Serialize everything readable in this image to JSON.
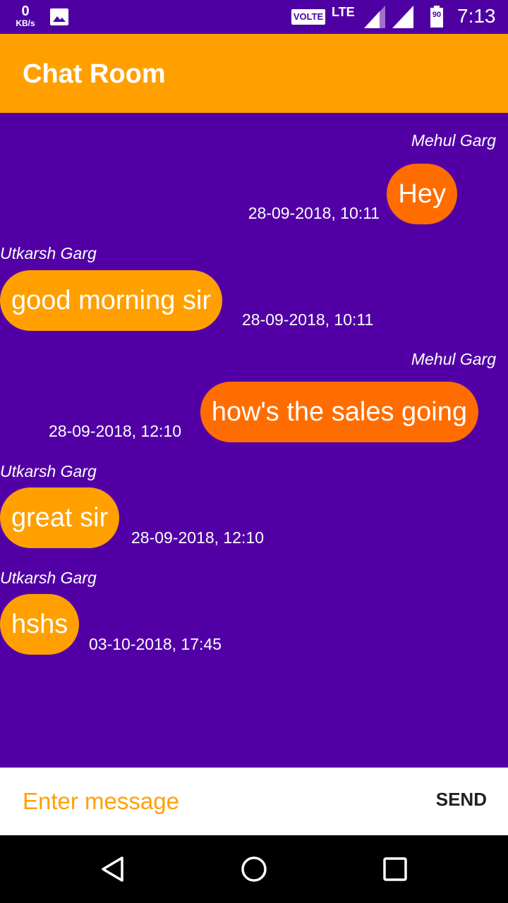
{
  "status_bar": {
    "net_speed_value": "0",
    "net_speed_unit": "KB/s",
    "volte_label": "VOLTE",
    "network_type": "LTE",
    "battery_level": "90",
    "time": "7:13"
  },
  "app_bar": {
    "title": "Chat Room"
  },
  "messages": [
    {
      "sender": "Mehul Garg",
      "text": "Hey",
      "timestamp": "28-09-2018, 10:11",
      "direction": "sent"
    },
    {
      "sender": "Utkarsh Garg",
      "text": "good morning sir",
      "timestamp": "28-09-2018, 10:11",
      "direction": "received"
    },
    {
      "sender": "Mehul Garg",
      "text": "how's the sales going",
      "timestamp": "28-09-2018, 12:10",
      "direction": "sent"
    },
    {
      "sender": "Utkarsh Garg",
      "text": "great sir",
      "timestamp": "28-09-2018, 12:10",
      "direction": "received"
    },
    {
      "sender": "Utkarsh Garg",
      "text": "hshs",
      "timestamp": "03-10-2018, 17:45",
      "direction": "received"
    }
  ],
  "input": {
    "placeholder": "Enter message",
    "value": "",
    "send_label": "SEND"
  },
  "colors": {
    "background": "#5200a6",
    "app_bar": "#ffa000",
    "sent_bubble": "#ff6d00",
    "received_bubble": "#ffa000"
  },
  "icons": {
    "status_bar": [
      "image-icon",
      "signal-icon",
      "battery-icon"
    ],
    "nav_bar": [
      "back-icon",
      "home-icon",
      "recents-icon"
    ]
  }
}
